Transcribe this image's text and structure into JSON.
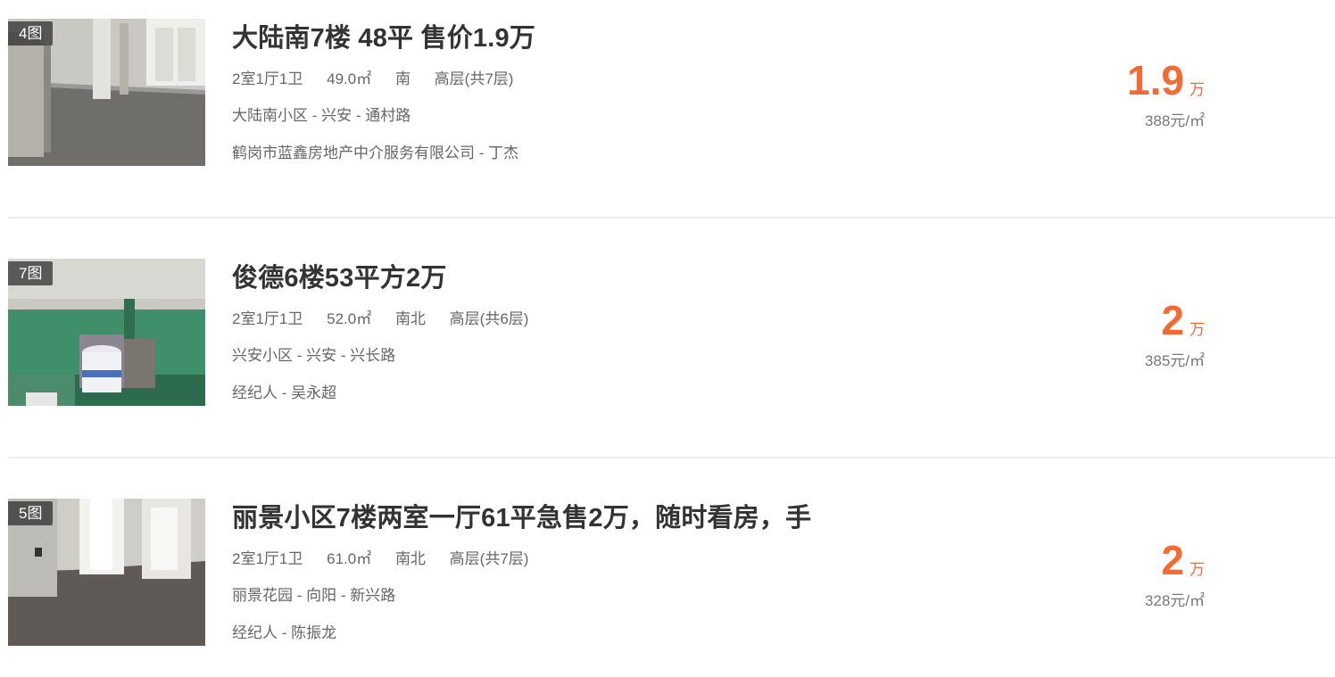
{
  "listings": [
    {
      "photo_count": "4图",
      "title": "大陆南7楼 48平 售价1.9万",
      "layout": "2室1厅1卫",
      "area": "49.0㎡",
      "orientation": "南",
      "floor": "高层(共7层)",
      "location": "大陆南小区 - 兴安 - 通村路",
      "agent": "鹤岗市蓝鑫房地产中介服务有限公司 - 丁杰",
      "price": "1.9",
      "price_unit": "万",
      "unit_price": "388元/㎡"
    },
    {
      "photo_count": "7图",
      "title": "俊德6楼53平方2万",
      "layout": "2室1厅1卫",
      "area": "52.0㎡",
      "orientation": "南北",
      "floor": "高层(共6层)",
      "location": "兴安小区 - 兴安 - 兴长路",
      "agent": "经纪人 - 吴永超",
      "price": "2",
      "price_unit": "万",
      "unit_price": "385元/㎡"
    },
    {
      "photo_count": "5图",
      "title": "丽景小区7楼两室一厅61平急售2万，随时看房，手",
      "layout": "2室1厅1卫",
      "area": "61.0㎡",
      "orientation": "南北",
      "floor": "高层(共7层)",
      "location": "丽景花园 - 向阳 - 新兴路",
      "agent": "经纪人 - 陈振龙",
      "price": "2",
      "price_unit": "万",
      "unit_price": "328元/㎡"
    }
  ],
  "colors": {
    "price": "#f56a32",
    "title": "#333333",
    "meta": "#666666",
    "divider": "#eeeeee"
  }
}
